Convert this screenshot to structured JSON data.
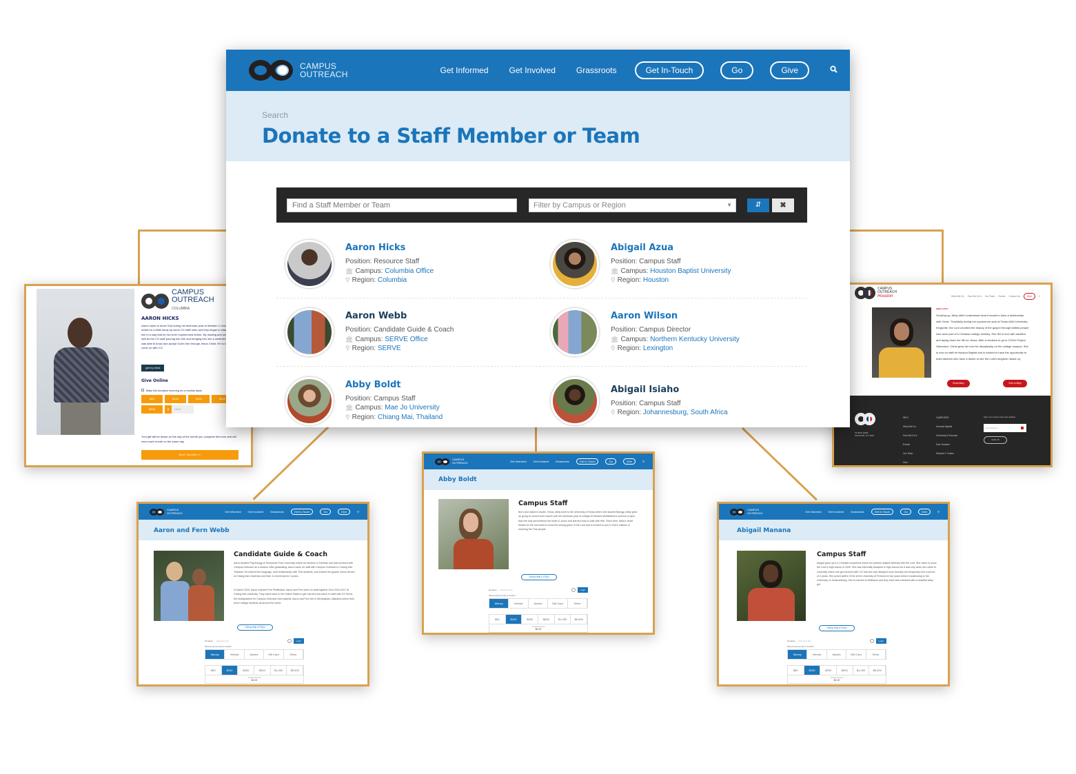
{
  "main": {
    "brand": {
      "line1": "CAMPUS",
      "line2": "OUTREACH"
    },
    "nav": [
      {
        "label": "Get Informed",
        "style": "link"
      },
      {
        "label": "Get Involved",
        "style": "link"
      },
      {
        "label": "Grassroots",
        "style": "link"
      },
      {
        "label": "Get In-Touch",
        "style": "pill"
      },
      {
        "label": "Go",
        "style": "pill"
      },
      {
        "label": "Give",
        "style": "pill"
      }
    ],
    "search_icon": "search-icon",
    "breadcrumb": "Search",
    "title": "Donate to a Staff Member or Team",
    "filter": {
      "search_placeholder": "Find a Staff Member or Team",
      "campus_placeholder": "Filter by Campus or Region",
      "sort_icon": "sort-icon",
      "clear_icon": "close-icon"
    },
    "labels": {
      "position": "Position:",
      "campus": "Campus:",
      "region": "Region:"
    },
    "staff": [
      {
        "name": "Aaron Hicks",
        "position": "Resource Staff",
        "campus": "Columbia Office",
        "region": "Columbia",
        "photo_color": "#6b5a4a"
      },
      {
        "name": "Abigail Azua",
        "position": "Campus Staff",
        "campus": "Houston Baptist University",
        "region": "Houston",
        "photo_color": "#c9a24a"
      },
      {
        "name": "Aaron Webb",
        "position": "Candidate Guide & Coach",
        "campus": "SERVE Office",
        "region": "SERVE",
        "photo_color": "#5b6e52"
      },
      {
        "name": "Aaron Wilson",
        "position": "Campus Director",
        "campus": "Northern Kentucky University",
        "region": "Lexington",
        "photo_color": "#6f8a62"
      },
      {
        "name": "Abby Boldt",
        "position": "Campus Staff",
        "campus": "Mae Jo University",
        "region": "Chiang Mai, Thailand",
        "photo_color": "#a77a5c"
      },
      {
        "name": "Abigail Isiaho",
        "position": "Campus Staff",
        "campus": null,
        "region": "Johannesburg, South Africa",
        "photo_color": "#b94a3a"
      }
    ]
  },
  "hicks_page": {
    "brand": {
      "line1": "CAMPUS",
      "line2": "OUTREACH",
      "sub": "COLUMBIA"
    },
    "name": "AARON HICKS",
    "bio": "Aaron came to know God during his freshman year at Western C University. He was invited to a bible study by some CO staff mem and they began to share God's word with him in a way that he ha never experienced before. By reading and understanding God's as well as the CO staff pouring into him and bringing him into a centered community, Aaron was able to know and accept God's him through Jesus Christ. He is now raising support to come on with CO.",
    "check_button": "give by check",
    "give_online": "Give Online",
    "recurring_label": "Make this donation recurring on a monthly basis.",
    "amounts": [
      "$50",
      "$100",
      "$150",
      "$200",
      "$300"
    ],
    "currency": "$",
    "other_placeholder": "Other",
    "note": "Your gift will be drawn on the day of the month you complete this form and will recur each month on the same day.",
    "next_button": "Next: Your Info >>"
  },
  "azua_page": {
    "brand": {
      "line1": "CAMPUS",
      "line2": "OUTREACH",
      "sub": "Houston"
    },
    "nav": [
      "What We Do",
      "How We Do It",
      "Our Team",
      "Events",
      "Contact Us"
    ],
    "give_button": "Give",
    "label": "ABBY AZUA",
    "bio": "Growing up, Abby didn't understand what it meant to have a relationship with Christ. Thankfully during her sophomore year at Texas A&M University-Kingsville, the Lord unveiled the beauty of the gospel through faithful people who were part of a Christian college ministry. She fell in love with sacrifice and laying down her life for Jesus. After a decision to go to COH's Project Galveston, Christ grew her love for discipleship on the college campus. She is now on staff at Houston Baptist and is excited to have the opportunity to build laborers who have a desire to see the Lord's kingdom raised up.",
    "email_button": "Email Abby",
    "give_to_button": "Give to Abby",
    "footer": {
      "address": [
        "PO BOX 10339",
        "HOUSTON, TX 77206"
      ],
      "info_title": "INFO",
      "info": [
        "What We Do",
        "How We Do It",
        "Events",
        "Our Team",
        "Give"
      ],
      "campuses_title": "CAMPUSES",
      "campuses": [
        "Houston Baptist",
        "University of Houston",
        "Sam Houston",
        "Stephen F. Austin"
      ],
      "signup_text": "Sign up to receive news and updates.",
      "email_placeholder": "Email Address",
      "signup_button": "SIGN UP"
    }
  },
  "profile_pages": [
    {
      "title": "Aaron and Fern Webb",
      "role": "Candidate Guide & Coach",
      "bio": "Aaron studied Psychology at Tennessee Tech University where he became a Christian and was involved with Campus Outreach as a student. After graduating, Aaron came on staff with Campus Outreach in Chiang Mai, Thailand. He learned the language, built relationships with Thai students, and shared the gospel. Aaron served at Chiang Mai University and Mae Jo University for 4 years.",
      "bio2": "In March 2020, Aaron married Fern Phatthaset. Aaron and Fern were on staff together from 2016-2017 at Chiang Mai University. They came back to the United States to get married and came on staff with CO Serve, the headquarters for Campus Outreach International. Aaron and Fern live in Birmingham, Alabama where they serve college students all around the world.",
      "photo_color": "#4a5a3e"
    },
    {
      "title": "Abby Boldt",
      "role": "Campus Staff",
      "bio": "Born and raised in Austin, Texas, Abby went to the University of Texas where she studied Biology. Abby grew up going to church but it wasn't until her freshman year of college at Student Mobilization's summer project that she truly surrendered her heart to Jesus and learned how to walk with Him. Since then, Abby's heart breaks for the lost world to know the saving grace of the Lord and is excited to join in God's mission in reaching the Thai people.",
      "bio2": "",
      "photo_color": "#8a7a5a"
    },
    {
      "title": "Abigail Manana",
      "role": "Campus Staff",
      "bio": "Abigail grew up in a Christian household where her parents walked faithfully with the Lord. She came to know the Lord in high school in 2009. She was informally discipled in high school but it was only when she came to university where she got involved with CO that she was discipled more formally and frequently over a period of 4 years. She joined staff in 2018 at the University of Pretoria for two years before transitioning to the University of Johannesburg. She is married to Mellolane and they have been blessed with a beautiful baby girl.",
      "bio2": "",
      "photo_color": "#a33a2e"
    }
  ],
  "donation_form": {
    "help_button": "Giving Help & FAQs",
    "steps": [
      "Donation",
      "Payment Info"
    ],
    "login_button": "Login",
    "question": "What would you like to donate?",
    "types": [
      "Money",
      "Vehicle",
      "Assets",
      "Gift Card",
      "Other"
    ],
    "selected_type": "Money",
    "amounts": [
      "$50",
      "$100",
      "$250",
      "$500",
      "$1,000",
      "$5,000"
    ],
    "selected_amount": "$100",
    "custom_label": "Custom Amount",
    "custom_value": "$0.00"
  },
  "colors": {
    "brand_blue": "#1b75ba",
    "hero_bg": "#dcebf5",
    "frame_gold": "#d8a24f",
    "orange": "#f79b0c",
    "houston_red": "#c8161d"
  }
}
